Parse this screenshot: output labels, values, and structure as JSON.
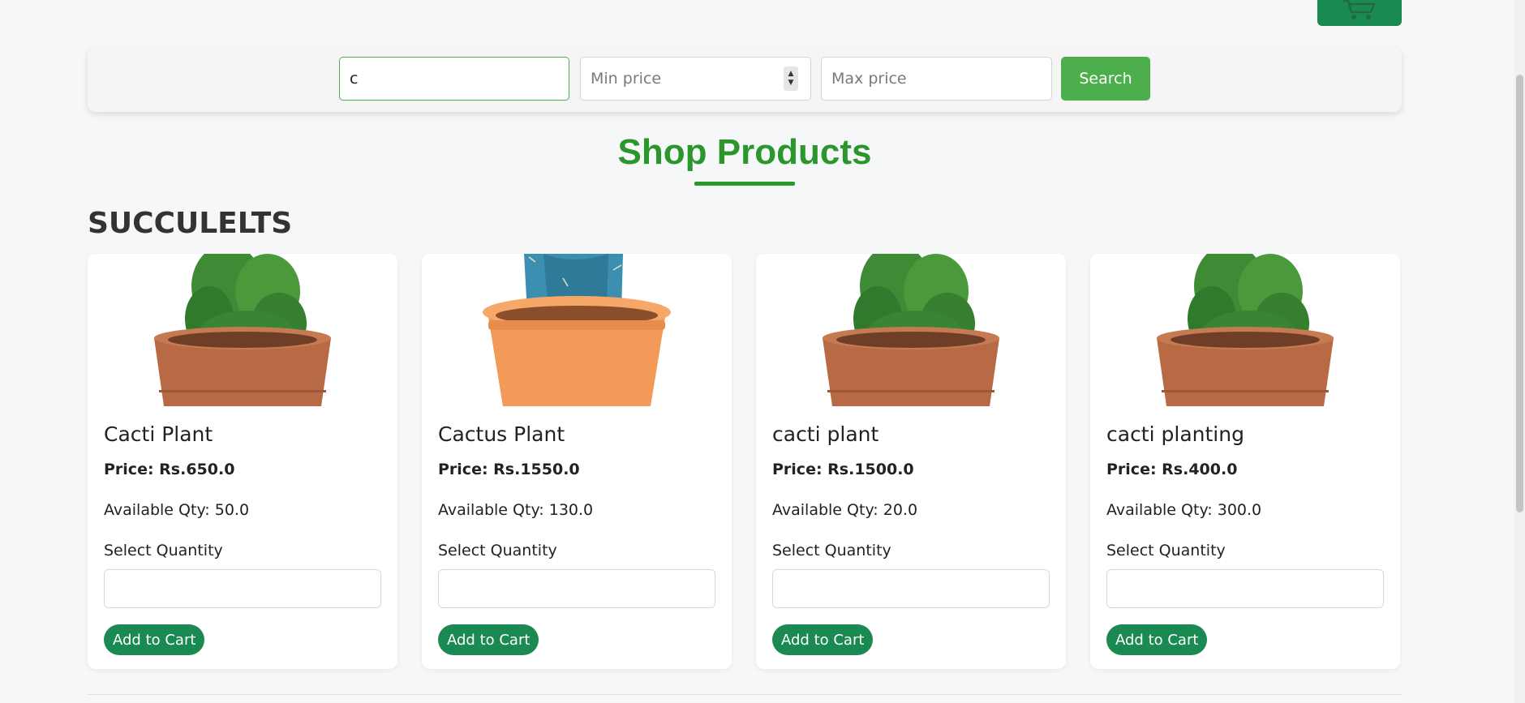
{
  "header": {
    "cart_icon": "shopping-cart-icon"
  },
  "search": {
    "query_value": "c",
    "query_placeholder": "",
    "min_price_placeholder": "Min price",
    "max_price_placeholder": "Max price",
    "button_label": "Search"
  },
  "page": {
    "title": "Shop Products",
    "category": "SUCCULELTS"
  },
  "colors": {
    "accent_green": "#2b962b",
    "button_green": "#1a8a52",
    "search_green": "#4cae4c"
  },
  "products": [
    {
      "name": "Cacti Plant",
      "price": "Price: Rs.650.0",
      "available": "Available Qty: 50.0",
      "qty_label": "Select Quantity",
      "qty_value": "",
      "button_label": "Add to Cart",
      "image": "cactus-in-brown-pot"
    },
    {
      "name": "Cactus Plant",
      "price": "Price: Rs.1550.0",
      "available": "Available Qty: 130.0",
      "qty_label": "Select Quantity",
      "qty_value": "",
      "button_label": "Add to Cart",
      "image": "blue-cactus-in-orange-pot"
    },
    {
      "name": "cacti plant",
      "price": "Price: Rs.1500.0",
      "available": "Available Qty: 20.0",
      "qty_label": "Select Quantity",
      "qty_value": "",
      "button_label": "Add to Cart",
      "image": "cactus-in-brown-pot"
    },
    {
      "name": "cacti planting",
      "price": "Price: Rs.400.0",
      "available": "Available Qty: 300.0",
      "qty_label": "Select Quantity",
      "qty_value": "",
      "button_label": "Add to Cart",
      "image": "cactus-in-brown-pot"
    }
  ]
}
